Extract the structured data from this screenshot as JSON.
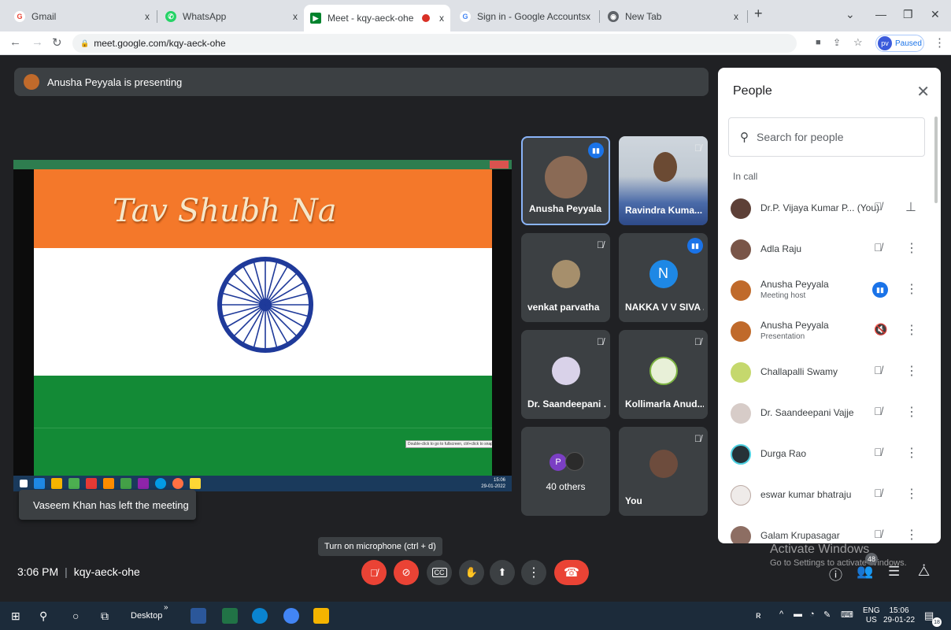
{
  "browser": {
    "tabs": [
      {
        "title": "Gmail",
        "close": "x"
      },
      {
        "title": "WhatsApp",
        "close": "x"
      },
      {
        "title": "Meet - kqy-aeck-ohe",
        "close": "x"
      },
      {
        "title": "Sign in - Google Accounts",
        "close": "x"
      },
      {
        "title": "New Tab",
        "close": "x"
      }
    ],
    "new_tab": "+",
    "url": "meet.google.com/kqy-aeck-ohe",
    "profile_initials": "pv",
    "profile_status": "Paused"
  },
  "meet": {
    "presenting_banner": "Anusha Peyyala is presenting",
    "presentation": {
      "slogan": "Tav Shubh Na",
      "hint": "Double-click to go to fullscreen, ctrl+click to snap to video size",
      "clock_time": "15:06",
      "clock_date": "29-01-2022"
    },
    "toast": "Vaseem Khan has left the meeting",
    "tiles": [
      {
        "name": "Anusha Peyyala"
      },
      {
        "name": "Ravindra Kuma..."
      },
      {
        "name": "venkat parvatha"
      },
      {
        "name": "NAKKA V V SIVA ...",
        "initial": "N"
      },
      {
        "name": "Dr. Saandeepani ..."
      },
      {
        "name": "Kollimarla Anud..."
      },
      {
        "name": "40 others",
        "initial": "P"
      },
      {
        "name": "You"
      }
    ],
    "time": "3:06 PM",
    "meeting_code": "kqy-aeck-ohe",
    "mic_tooltip": "Turn on microphone (ctrl + d)",
    "controls": {
      "captions": "CC"
    },
    "participant_count": "48",
    "activate_title": "Activate Windows",
    "activate_sub": "Go to Settings to activate Windows."
  },
  "people": {
    "title": "People",
    "search_placeholder": "Search for people",
    "section": "In call",
    "rows": [
      {
        "name": "Dr.P. Vijaya Kumar P...",
        "tag": "(You)"
      },
      {
        "name": "Adla Raju"
      },
      {
        "name": "Anusha Peyyala",
        "sub": "Meeting host"
      },
      {
        "name": "Anusha Peyyala",
        "sub": "Presentation"
      },
      {
        "name": "Challapalli Swamy"
      },
      {
        "name": "Dr. Saandeepani Vajje"
      },
      {
        "name": "Durga Rao"
      },
      {
        "name": "eswar kumar bhatraju"
      },
      {
        "name": "Galam Krupasagar"
      }
    ]
  },
  "taskbar": {
    "desktop_label": "Desktop",
    "chevron": "»",
    "lang": "ENG",
    "region": "US",
    "time": "15:06",
    "date": "29-01-22",
    "notifications": "18"
  },
  "colors": {
    "accent": "#1a73e8",
    "danger": "#ea4335",
    "saffron": "#f4782a",
    "india_green": "#138a36",
    "chakra": "#1f3a9a"
  }
}
